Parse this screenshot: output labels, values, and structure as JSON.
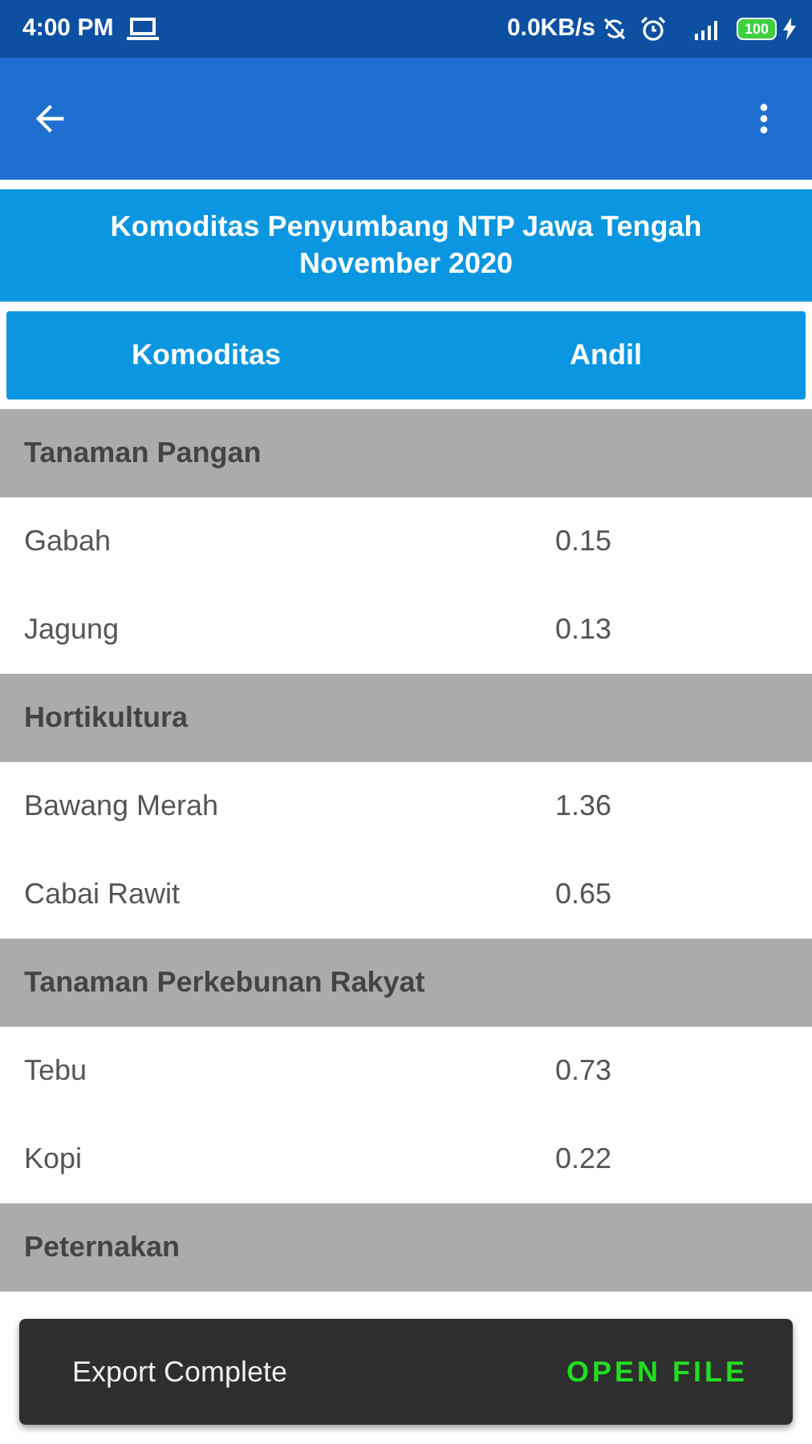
{
  "status_bar": {
    "time": "4:00 PM",
    "speed": "0.0KB/s",
    "battery": "100"
  },
  "title": {
    "line_1": "Komoditas Penyumbang NTP Jawa Tengah",
    "line_2": "November 2020"
  },
  "table": {
    "columns": [
      "Komoditas",
      "Andil"
    ],
    "groups": [
      {
        "name": "Tanaman Pangan",
        "rows": [
          {
            "name": "Gabah",
            "value": "0.15"
          },
          {
            "name": "Jagung",
            "value": "0.13"
          }
        ]
      },
      {
        "name": "Hortikultura",
        "rows": [
          {
            "name": "Bawang Merah",
            "value": "1.36"
          },
          {
            "name": "Cabai Rawit",
            "value": "0.65"
          }
        ]
      },
      {
        "name": "Tanaman Perkebunan Rakyat",
        "rows": [
          {
            "name": "Tebu",
            "value": "0.73"
          },
          {
            "name": "Kopi",
            "value": "0.22"
          }
        ]
      },
      {
        "name": "Peternakan"
      }
    ]
  },
  "snackbar": {
    "message": "Export Complete",
    "action": "OPEN FILE"
  }
}
